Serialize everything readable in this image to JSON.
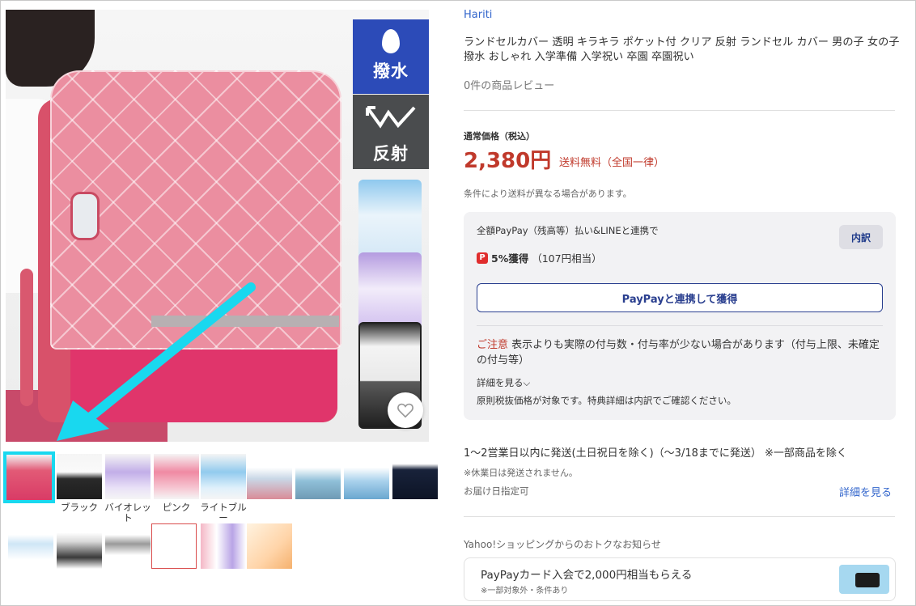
{
  "store": {
    "name": "Hariti"
  },
  "product": {
    "title": "ランドセルカバー 透明 キラキラ ポケット付 クリア 反射 ランドセル カバー 男の子 女の子 撥水 おしゃれ 入学準備 入学祝い 卒園 卒園祝い",
    "review_count_text": "0件の商品レビュー"
  },
  "main_image": {
    "badges": {
      "water": "撥水",
      "reflect": "反射"
    }
  },
  "thumbnails": {
    "row1": [
      {
        "caption": "",
        "kind": "pink-bag",
        "selected": true
      },
      {
        "caption": "ブラック",
        "kind": "black-cover"
      },
      {
        "caption": "バイオレット",
        "kind": "violet-cover"
      },
      {
        "caption": "ピンク",
        "kind": "pink-cover"
      },
      {
        "caption": "ライトブルー",
        "kind": "blue-cover"
      },
      {
        "caption": "",
        "kind": "info-photo"
      },
      {
        "caption": "",
        "kind": "info-photo-2"
      },
      {
        "caption": "",
        "kind": "info-photo-3"
      },
      {
        "caption": "",
        "kind": "night-photo"
      }
    ],
    "row2": [
      {
        "caption": "",
        "kind": "size-diagram"
      },
      {
        "caption": "",
        "kind": "product-detail"
      },
      {
        "caption": "",
        "kind": "size-diagram-2"
      },
      {
        "caption": "",
        "kind": "notice-sheet"
      },
      {
        "caption": "",
        "kind": "color-variation"
      },
      {
        "caption": "",
        "kind": "promo-sheet"
      }
    ]
  },
  "price": {
    "label": "通常価格（税込）",
    "value": "2,380円",
    "shipping": "送料無料（全国一律）",
    "shipping_note": "条件により送料が異なる場合があります。"
  },
  "paypay": {
    "condition": "全額PayPay（残高等）払い&LINEと連携で",
    "breakdown_button": "内訳",
    "logo_char": "P",
    "earn_bold": "5%獲得",
    "earn_rest": "（107円相当）",
    "link_button": "PayPayと連携して獲得",
    "caution_label": "ご注意",
    "caution_text": " 表示よりも実際の付与数・付与率が少ない場合があります（付与上限、未確定の付与等）",
    "details_link": "詳細を見る",
    "details_chevron": "⌵",
    "tax_note": "原則税抜価格が対象です。特典詳細は内訳でご確認ください。"
  },
  "delivery": {
    "text": "1〜2営業日以内に発送(土日祝日を除く)（〜3/18までに発送） ※一部商品を除く",
    "holiday_note": "※休業日は発送されません。",
    "date_specify": "お届け日指定可",
    "more_details": "詳細を見る"
  },
  "notice": {
    "title": "Yahoo!ショッピングからのおトクなお知らせ",
    "promo_main": "PayPayカード入会で2,000円相当もらえる",
    "promo_sub": "※一部対象外・条件あり"
  },
  "colors": {
    "accent_blue": "#3366cc",
    "price_red": "#c0392b",
    "paypay_navy": "#2a3f8f",
    "highlight_cyan": "#19d8ef"
  }
}
